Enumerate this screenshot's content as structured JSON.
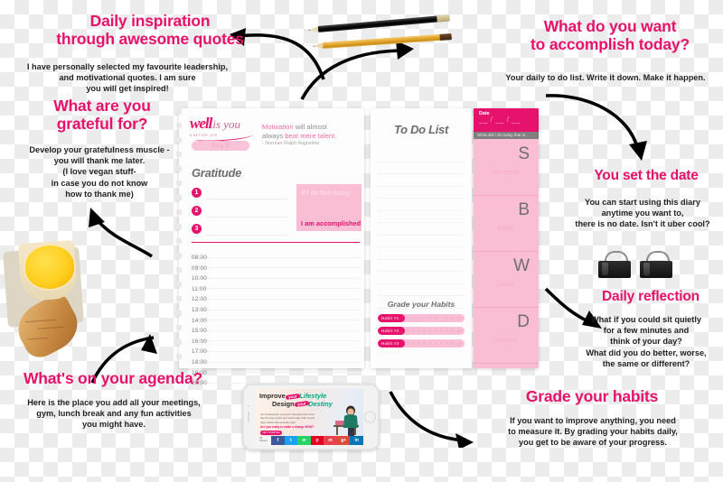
{
  "headlines": {
    "inspiration": "Daily inspiration\nthrough awesome quotes",
    "inspiration_body": "I have personally selected my favourite leadership,\nand motivational quotes. I am sure\nyou will get inspired!",
    "grateful": "What are you\ngrateful for?",
    "grateful_body": "Develop your gratefulness muscle -\nyou will thank me later.\n(I love vegan stuff-\nin case you do not know\nhow to thank me)",
    "accomplish": "What do you want\nto accomplish today?",
    "accomplish_body": "Your daily to do list. Write it down. Make it happen.",
    "setdate": "You set the date",
    "setdate_body": "You can start using this diary\nanytime you want to,\nthere is no date. Isn't it uber cool?",
    "reflection": "Daily reflection",
    "reflection_body": "What if you could sit quietly\nfor a few minutes and\nthink of your day?\nWhat did you do better, worse,\nthe same or different?",
    "agenda": "What's on your agenda?",
    "agenda_body": "Here is the place you add all your meetings,\ngym, lunch break and any fun activities\nyou might have.",
    "habits": "Grade your habits",
    "habits_body": "If you want to improve anything, you need\nto measure it. By grading your habits daily,\nyou get to be aware of your progress."
  },
  "diary": {
    "logo_main": "well",
    "logo_sub": "is you",
    "logo_tagline": "A BETTER LIFE",
    "day_badge": "Day 2",
    "quote_line1_a": "Motivation",
    "quote_line1_b": " will almost",
    "quote_line2_a": "always ",
    "quote_line2_b": "beat mere talent.",
    "quote_source": "- Norman Ralph Augustine",
    "gratitude_title": "Gratitude",
    "gratitude_numbers": [
      "1",
      "2",
      "3"
    ],
    "if_today": "If I do this today",
    "accomplished": "I am accomplished",
    "hours": [
      "08:00",
      "09:00",
      "10:00",
      "11:00",
      "12:00",
      "13:00",
      "14:00",
      "15:00",
      "16:00",
      "17:00",
      "18:00",
      "19:00",
      "20:00"
    ]
  },
  "todo": {
    "title": "To Do List",
    "habits_title": "Grade your Habits",
    "habits": [
      {
        "label": "Habit #1",
        "ticks": [
          "1",
          "2",
          "3",
          "4",
          "5",
          "6",
          "7",
          "8",
          "9",
          "10"
        ]
      },
      {
        "label": "Habit #2",
        "ticks": [
          "1",
          "2",
          "3",
          "4",
          "5",
          "6",
          "7",
          "8",
          "9",
          "10"
        ]
      },
      {
        "label": "Habit #3",
        "ticks": [
          "1",
          "2",
          "3",
          "4",
          "5",
          "6",
          "7",
          "8",
          "9",
          "10"
        ]
      }
    ]
  },
  "reflection_column": {
    "date_label": "Date",
    "date_slots": "__ / __ / __",
    "prompt": "What did I do today that is...",
    "cells": [
      {
        "letter": "S",
        "word": "the same"
      },
      {
        "letter": "B",
        "word": "better"
      },
      {
        "letter": "W",
        "word": "worse"
      },
      {
        "letter": "D",
        "word": "different"
      }
    ]
  },
  "phone": {
    "hero_l1_a": "Improve",
    "hero_l1_pill": "your",
    "hero_l1_b": "Lifestyle",
    "hero_l2_a": "Design",
    "hero_l2_pill": "your",
    "hero_l2_b": "Destiny",
    "sub": "Join thousands of people changing their lives. Get the free guide and start today with simple daily habits that actually stick.",
    "cta": "Are you ready to make a change NOW?",
    "button": "GET STARTED",
    "share_count": "48\nShares",
    "share_icons": [
      "f",
      "t",
      "w",
      "p",
      "m",
      "g+",
      "in"
    ]
  },
  "colors": {
    "accent": "#e6126b",
    "light_pink": "#f9bdd4",
    "dark_text": "#231f20"
  }
}
